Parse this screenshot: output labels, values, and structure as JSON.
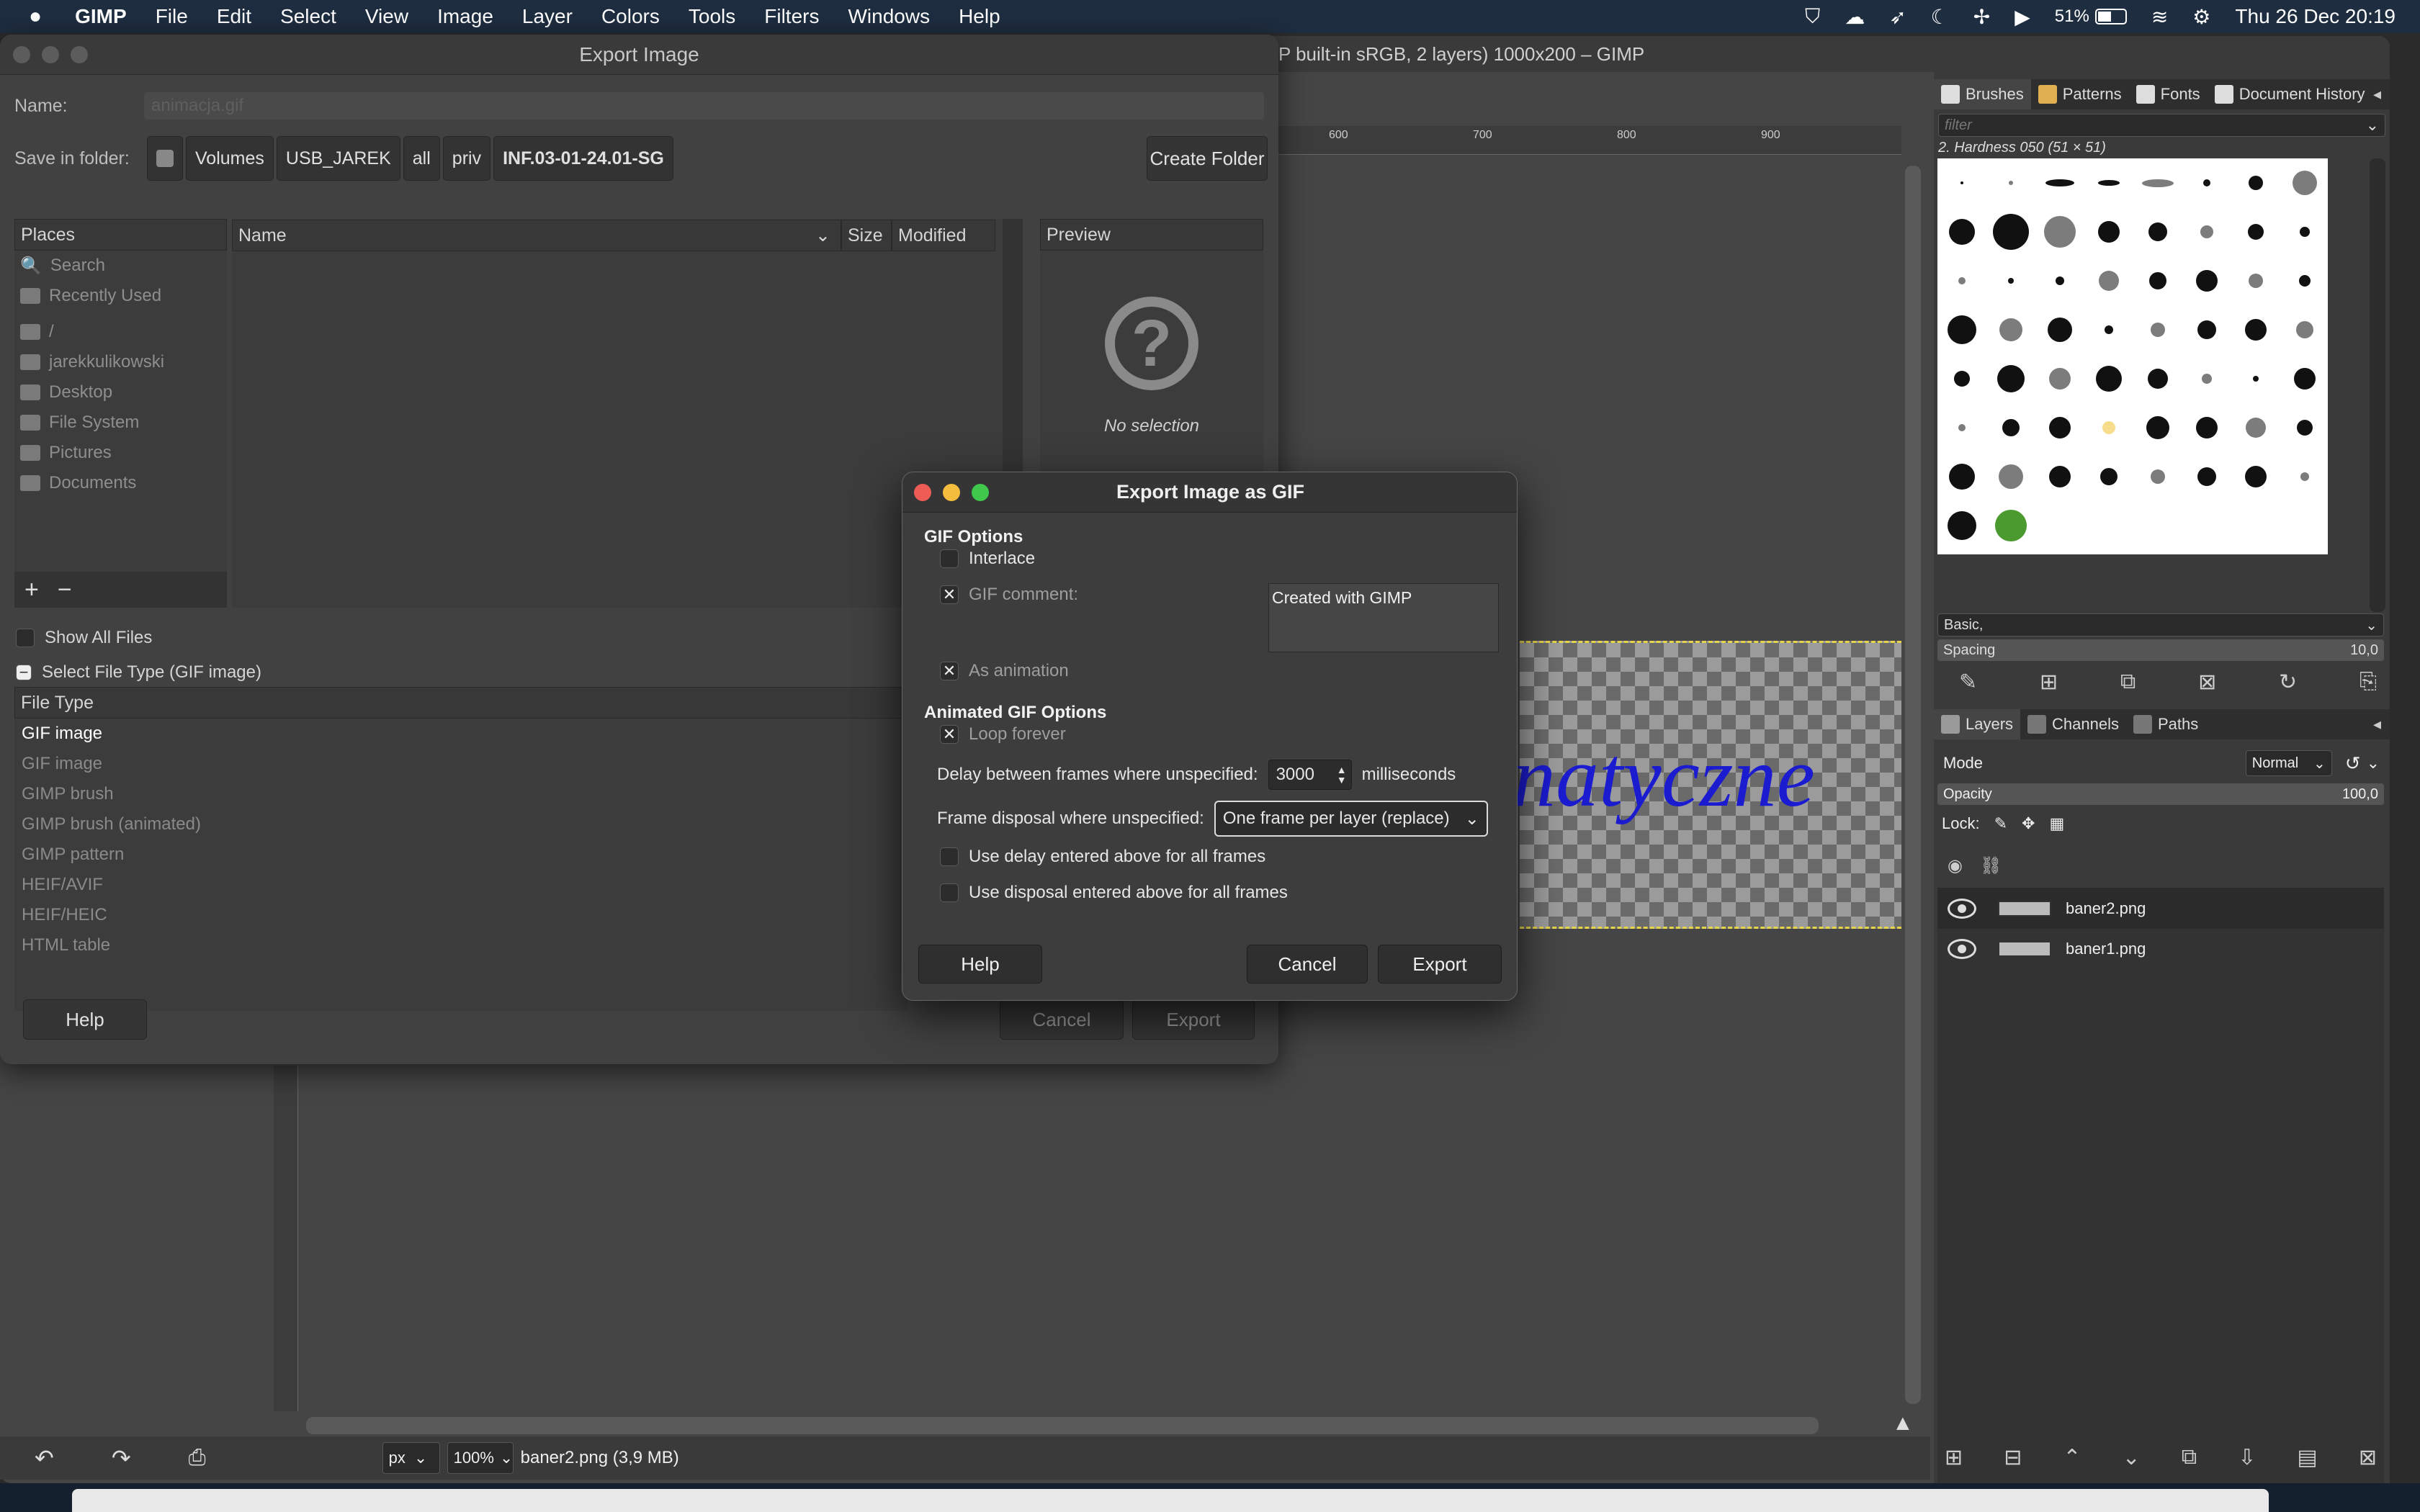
{
  "menubar": {
    "apple": "",
    "app": "GIMP",
    "items": [
      "File",
      "Edit",
      "Select",
      "View",
      "Image",
      "Layer",
      "Colors",
      "Tools",
      "Filters",
      "Windows",
      "Help"
    ],
    "battery": "51%",
    "datetime": "Thu 26 Dec  20:19"
  },
  "gimp": {
    "title": "P built-in sRGB, 2 layers) 1000x200 – GIMP",
    "ruler_ticks": [
      "600",
      "700",
      "800",
      "900"
    ],
    "canvas_text": "natyczne",
    "status": {
      "unit": "px",
      "zoom": "100%",
      "file": "baner2.png (3,9 MB)"
    }
  },
  "dock": {
    "tabs": [
      "Brushes",
      "Patterns",
      "Fonts",
      "Document History"
    ],
    "filter_placeholder": "filter",
    "brush_name": "2. Hardness 050 (51 × 51)",
    "brush_set": "Basic,",
    "spacing_label": "Spacing",
    "spacing_value": "10,0",
    "layer_tabs": [
      "Layers",
      "Channels",
      "Paths"
    ],
    "mode_label": "Mode",
    "mode_value": "Normal",
    "opacity_label": "Opacity",
    "opacity_value": "100,0",
    "lock_label": "Lock:",
    "layers": [
      "baner2.png",
      "baner1.png"
    ]
  },
  "export": {
    "title": "Export Image",
    "name_label": "Name:",
    "name_value": "animacja.gif",
    "save_in_label": "Save in folder:",
    "path": [
      "Volumes",
      "USB_JAREK",
      "all",
      "priv",
      "INF.03-01-24.01-SG"
    ],
    "create_folder": "Create Folder",
    "places_header": "Places",
    "places": [
      "Search",
      "Recently Used",
      "/",
      "jarekkulikowski",
      "Desktop",
      "File System",
      "Pictures",
      "Documents"
    ],
    "col_name": "Name",
    "col_size": "Size",
    "col_modified": "Modified",
    "preview_header": "Preview",
    "preview_empty": "No selection",
    "show_all_files": "Show All Files",
    "select_file_type": "Select File Type (GIF image)",
    "file_type_header": "File Type",
    "file_types": [
      "GIF image",
      "GIF image",
      "GIMP brush",
      "GIMP brush (animated)",
      "GIMP pattern",
      "HEIF/AVIF",
      "HEIF/HEIC",
      "HTML table"
    ],
    "help": "Help",
    "cancel": "Cancel",
    "export": "Export"
  },
  "gif": {
    "title": "Export Image as GIF",
    "options_header": "GIF Options",
    "interlace": "Interlace",
    "gif_comment": "GIF comment:",
    "comment_value": "Created with GIMP",
    "as_animation": "As animation",
    "anim_header": "Animated GIF Options",
    "loop_forever": "Loop forever",
    "delay_label": "Delay between frames where unspecified:",
    "delay_value": "3000",
    "delay_unit": "milliseconds",
    "disposal_label": "Frame disposal where unspecified:",
    "disposal_value": "One frame per layer (replace)",
    "use_delay": "Use delay entered above for all frames",
    "use_disposal": "Use disposal entered above for all frames",
    "help": "Help",
    "cancel": "Cancel",
    "export": "Export"
  }
}
